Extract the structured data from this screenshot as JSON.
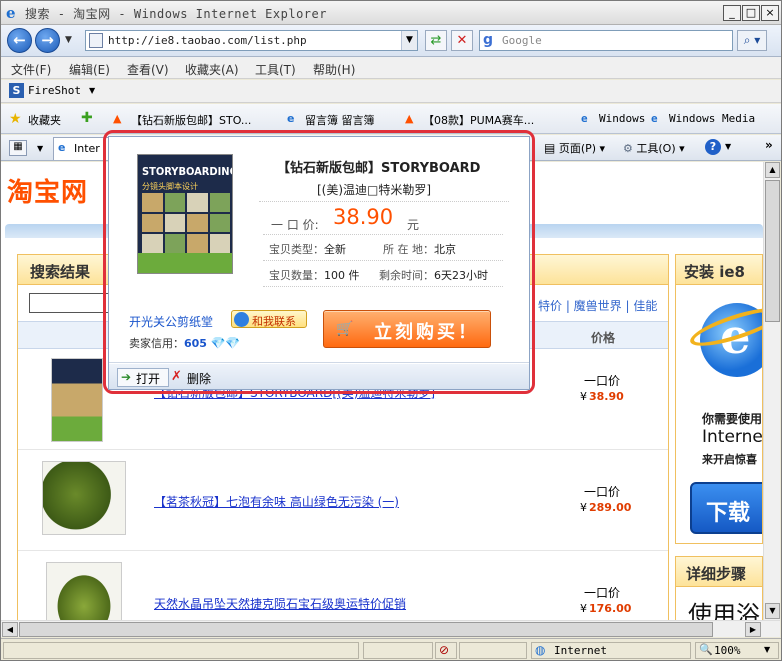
{
  "window": {
    "title": "搜索 - 淘宝网 - Windows Internet Explorer",
    "controls": [
      "_",
      "□",
      "×"
    ]
  },
  "address": {
    "url": "http://ie8.taobao.com/list.php",
    "search_placeholder": "Google"
  },
  "menu": [
    "文件(F)",
    "编辑(E)",
    "查看(V)",
    "收藏夹(A)",
    "工具(T)",
    "帮助(H)"
  ],
  "fireshot": "FireShot",
  "favorites": {
    "label": "收藏夹",
    "items": [
      "【钻石新版包邮】STO...",
      "留言簿 留言簿",
      "【08款】PUMA赛车...",
      "Windows",
      "Windows Media"
    ]
  },
  "tabs": {
    "current": "Inter",
    "page_label": "页面(P)",
    "tools_label": "工具(O)",
    "help_label": "?"
  },
  "page": {
    "logo": "淘宝网",
    "results_title": "搜索结果",
    "category_links": "特价 | 魔兽世界 | 佳能",
    "price_col": "价格",
    "items": [
      {
        "title": "【钻石新版包邮】STORYBOARD[(美)温迪特米勒罗]",
        "price_label": "一口价",
        "price": "38.90"
      },
      {
        "title": "【茗茶秋冠】七泡有余味 高山绿色无污染 (一)",
        "price_label": "一口价",
        "price": "289.00"
      },
      {
        "title": "天然水晶吊坠天然捷克陨石宝石级奥运特价促销",
        "price_label": "一口价",
        "price": "176.00"
      }
    ],
    "ie8_box": {
      "title": "安装 ie8",
      "need": "你需要使用",
      "brand": "Interne",
      "come": "来开启惊喜",
      "download": "下载"
    },
    "steps_box": {
      "title": "详细步骤",
      "big": "使用浴"
    }
  },
  "popup": {
    "book_cover_title": "STORYBOARDING",
    "book_cover_sub": "分镜头脚本设计",
    "title": "【钻石新版包邮】STORYBOARD",
    "author": "[(美)温迪□特米勒罗]",
    "price_label": "一 口 价:",
    "price": "38.90",
    "price_unit": "元",
    "type_label": "宝贝类型：",
    "type_value": "全新",
    "location_label": "所 在 地：",
    "location_value": "北京",
    "qty_label": "宝贝数量：",
    "qty_value": "100 件",
    "remain_label": "剩余时间：",
    "remain_value": "6天23小时",
    "seller": "开光关公剪纸堂",
    "chat": "和我联系",
    "credit_label": "卖家信用：",
    "credit_value": "605",
    "buy": "立刻购买！",
    "open": "打开",
    "delete": "删除"
  },
  "status": {
    "zone": "Internet",
    "zoom": "100%"
  },
  "colors": {
    "taobao_orange": "#ff5000",
    "popup_outline": "#e0303a",
    "link_blue": "#1a33cc"
  }
}
